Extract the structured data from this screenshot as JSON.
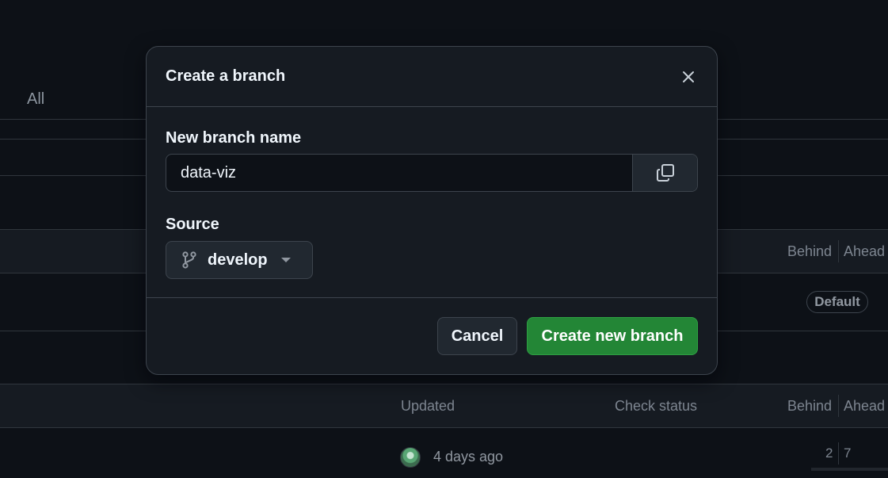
{
  "background": {
    "tab_all_label": "All",
    "default_section": {
      "headers": {
        "behind": "Behind",
        "ahead": "Ahead"
      },
      "default_badge": "Default"
    },
    "branch_table": {
      "headers": {
        "updated": "Updated",
        "check_status": "Check status",
        "behind": "Behind",
        "ahead": "Ahead"
      },
      "rows": [
        {
          "updated": "4 days ago",
          "behind": "2",
          "ahead": "7"
        }
      ]
    }
  },
  "dialog": {
    "title": "Create a branch",
    "new_branch_label": "New branch name",
    "new_branch_value": "data-viz",
    "source_label": "Source",
    "source_branch": "develop",
    "cancel_label": "Cancel",
    "create_label": "Create new branch"
  },
  "colors": {
    "page_bg": "#0d1117",
    "dialog_bg": "#161b22",
    "primary_button": "#238636",
    "border": "#3d444d"
  },
  "icons": {
    "close": "close-icon",
    "copy": "copy-icon",
    "branch": "git-branch-icon",
    "caret": "triangle-down-icon"
  }
}
